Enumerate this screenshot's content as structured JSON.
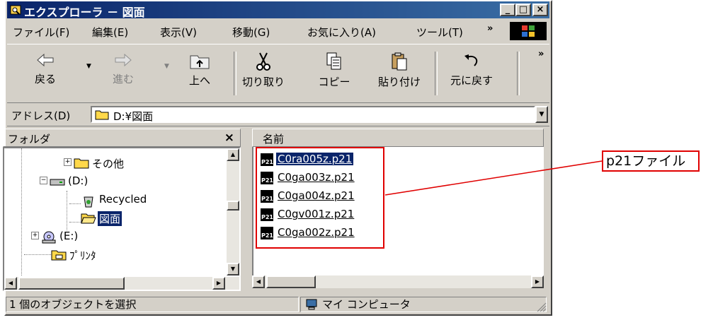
{
  "window": {
    "title": "エクスプローラ － 図面",
    "controls": {
      "minimize": "_",
      "maximize": "□",
      "close": "×"
    }
  },
  "menu": {
    "items": [
      "ファイル(F)",
      "編集(E)",
      "表示(V)",
      "移動(G)",
      "お気に入り(A)",
      "ツール(T)"
    ],
    "overflow": "»"
  },
  "toolbar": {
    "buttons": [
      {
        "label": "戻る",
        "icon": "back-arrow-icon"
      },
      {
        "label": "進む",
        "icon": "forward-arrow-icon"
      },
      {
        "label": "上へ",
        "icon": "up-folder-icon"
      },
      {
        "label": "切り取り",
        "icon": "scissors-icon"
      },
      {
        "label": "コピー",
        "icon": "copy-icon"
      },
      {
        "label": "貼り付け",
        "icon": "paste-icon"
      },
      {
        "label": "元に戻す",
        "icon": "undo-icon"
      }
    ],
    "overflow": "»"
  },
  "address": {
    "label": "アドレス(D)",
    "value": "D:¥図面"
  },
  "folder_pane": {
    "title": "フォルダ",
    "close": "×",
    "tree": [
      {
        "label": "その他",
        "icon": "folder-icon"
      },
      {
        "label": "(D:)",
        "icon": "drive-icon"
      },
      {
        "label": "Recycled",
        "icon": "recycle-bin-icon"
      },
      {
        "label": "図面",
        "icon": "open-folder-icon",
        "selected": true
      },
      {
        "label": "(E:)",
        "icon": "cd-drive-icon"
      },
      {
        "label": "ﾌﾟﾘﾝﾀ",
        "icon": "printer-folder-icon"
      }
    ]
  },
  "file_pane": {
    "column_header": "名前",
    "files": [
      {
        "name": "C0ra005z.p21",
        "selected": true
      },
      {
        "name": "C0ga003z.p21",
        "selected": false
      },
      {
        "name": "C0ga004z.p21",
        "selected": false
      },
      {
        "name": "C0gv001z.p21",
        "selected": false
      },
      {
        "name": "C0ga002z.p21",
        "selected": false
      }
    ],
    "file_icon_text": "P21"
  },
  "annotation": {
    "label": "p21ファイル",
    "color": "#e00000"
  },
  "status": {
    "selection": "1 個のオブジェクトを選択",
    "location": "マイ コンピュータ"
  },
  "colors": {
    "titlebar": "#0a246a",
    "face": "#d4d0c8",
    "selection": "#0a246a"
  }
}
